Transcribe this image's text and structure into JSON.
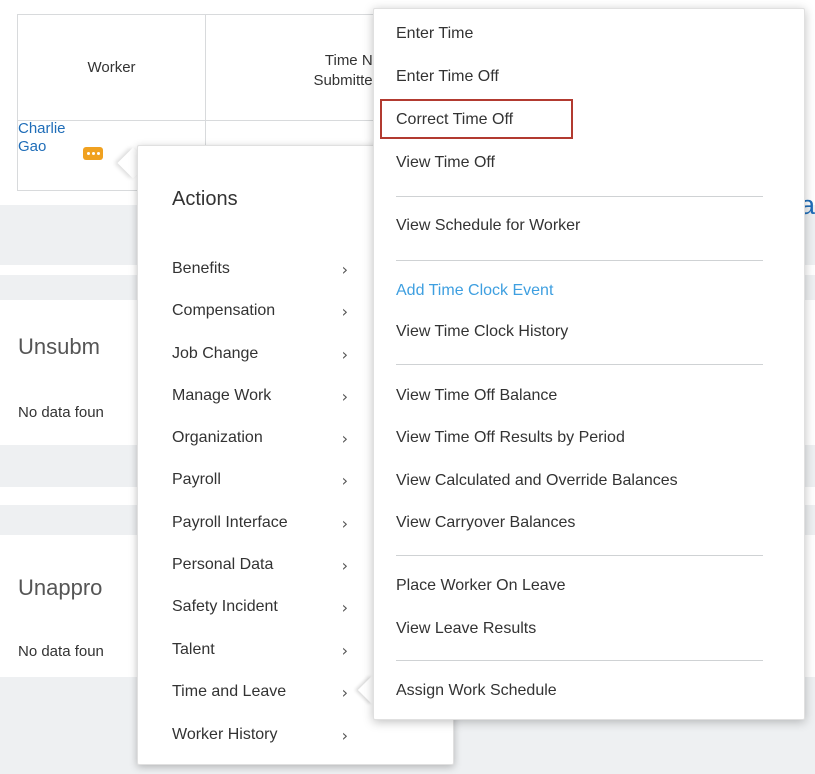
{
  "table": {
    "header_worker": "Worker",
    "header_time_line1": "Time No",
    "header_time_line2": "Submitted",
    "worker_first": "Charlie",
    "worker_last": "Gao"
  },
  "page": {
    "section1_title": "Unsubm",
    "section1_empty": "No data foun",
    "section2_title": "Unappro",
    "section2_empty": "No data foun",
    "right_fragment": "a"
  },
  "actions_menu": {
    "title": "Actions",
    "items": [
      {
        "label": "Benefits"
      },
      {
        "label": "Compensation"
      },
      {
        "label": "Job Change"
      },
      {
        "label": "Manage Work"
      },
      {
        "label": "Organization"
      },
      {
        "label": "Payroll"
      },
      {
        "label": "Payroll Interface"
      },
      {
        "label": "Personal Data"
      },
      {
        "label": "Safety Incident"
      },
      {
        "label": "Talent"
      },
      {
        "label": "Time and Leave"
      },
      {
        "label": "Worker History"
      }
    ],
    "chevron": "›"
  },
  "submenu": {
    "items": [
      {
        "label": "Enter Time"
      },
      {
        "label": "Enter Time Off"
      },
      {
        "label": "Correct Time Off"
      },
      {
        "label": "View Time Off"
      },
      {
        "label": "View Schedule for Worker"
      },
      {
        "label": "Add Time Clock Event"
      },
      {
        "label": "View Time Clock History"
      },
      {
        "label": "View Time Off Balance"
      },
      {
        "label": "View Time Off Results by Period"
      },
      {
        "label": "View Calculated and Override Balances"
      },
      {
        "label": "View Carryover Balances"
      },
      {
        "label": "Place Worker On Leave"
      },
      {
        "label": "View Leave Results"
      },
      {
        "label": "Assign Work Schedule"
      }
    ]
  },
  "colors": {
    "link": "#1f6db8",
    "hover_link": "#3e9fe0",
    "highlight": "#b23a30",
    "related_button": "#f0a120"
  },
  "icons": {
    "related_actions": "related-actions-icon",
    "chevron": "chevron-right-icon"
  }
}
